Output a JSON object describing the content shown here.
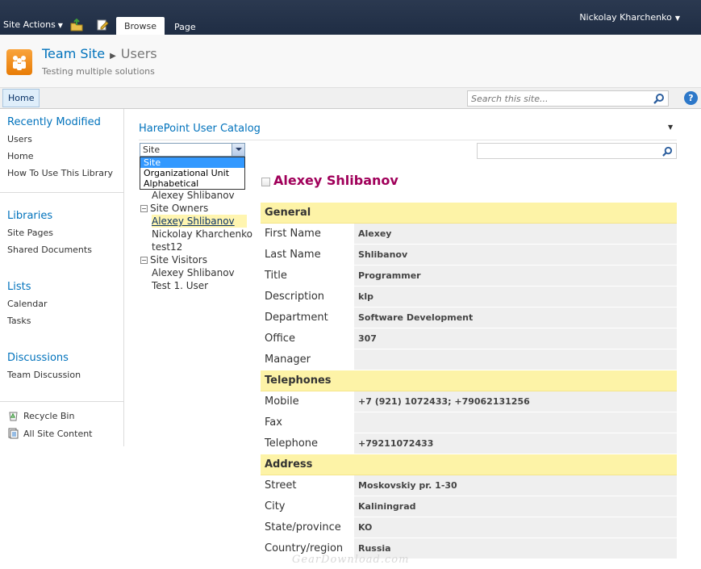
{
  "ribbon": {
    "site_actions": "Site Actions",
    "tabs": [
      "Browse",
      "Page"
    ],
    "active_tab": "Browse",
    "user": "Nickolay Kharchenko"
  },
  "header": {
    "site_title": "Team Site",
    "page_title": "Users",
    "description": "Testing multiple solutions"
  },
  "topnav": {
    "home": "Home",
    "search_placeholder": "Search this site..."
  },
  "leftnav": {
    "recently_modified": {
      "heading": "Recently Modified",
      "items": [
        "Users",
        "Home",
        "How To Use This Library"
      ]
    },
    "libraries": {
      "heading": "Libraries",
      "items": [
        "Site Pages",
        "Shared Documents"
      ]
    },
    "lists": {
      "heading": "Lists",
      "items": [
        "Calendar",
        "Tasks"
      ]
    },
    "discussions": {
      "heading": "Discussions",
      "items": [
        "Team Discussion"
      ]
    },
    "recycle_bin": "Recycle Bin",
    "all_site_content": "All Site Content"
  },
  "webpart": {
    "title": "HarePoint User Catalog",
    "group_by": {
      "selected": "Site",
      "options": [
        "Site",
        "Organizational Unit",
        "Alphabetical"
      ]
    },
    "tree": {
      "first_member": "Alexey Shlibanov",
      "groups": [
        {
          "name": "Site Owners",
          "members": [
            "Alexey Shlibanov",
            "Nickolay Kharchenko",
            "test12"
          ]
        },
        {
          "name": "Site Visitors",
          "members": [
            "Alexey Shlibanov",
            "Test 1. User"
          ]
        }
      ]
    }
  },
  "profile": {
    "name": "Alexey Shlibanov",
    "sections": {
      "general": {
        "title": "General",
        "rows": [
          {
            "label": "First Name",
            "value": "Alexey"
          },
          {
            "label": "Last Name",
            "value": "Shlibanov"
          },
          {
            "label": "Title",
            "value": "Programmer"
          },
          {
            "label": "Description",
            "value": "klp"
          },
          {
            "label": "Department",
            "value": "Software Development"
          },
          {
            "label": "Office",
            "value": "307"
          },
          {
            "label": "Manager",
            "value": ""
          }
        ]
      },
      "telephones": {
        "title": "Telephones",
        "rows": [
          {
            "label": "Mobile",
            "value": "+7 (921) 1072433; +79062131256"
          },
          {
            "label": "Fax",
            "value": ""
          },
          {
            "label": "Telephone",
            "value": "+79211072433"
          }
        ]
      },
      "address": {
        "title": "Address",
        "rows": [
          {
            "label": "Street",
            "value": "Moskovskiy pr. 1-30"
          },
          {
            "label": "City",
            "value": "Kaliningrad"
          },
          {
            "label": "State/province",
            "value": "KO"
          },
          {
            "label": "Country/region",
            "value": "Russia"
          }
        ]
      }
    }
  },
  "watermark": "GearDownload.com",
  "colors": {
    "accent": "#0072bc",
    "name": "#a0005a",
    "section": "#fdf3a7",
    "ribbon": "#22304a"
  }
}
